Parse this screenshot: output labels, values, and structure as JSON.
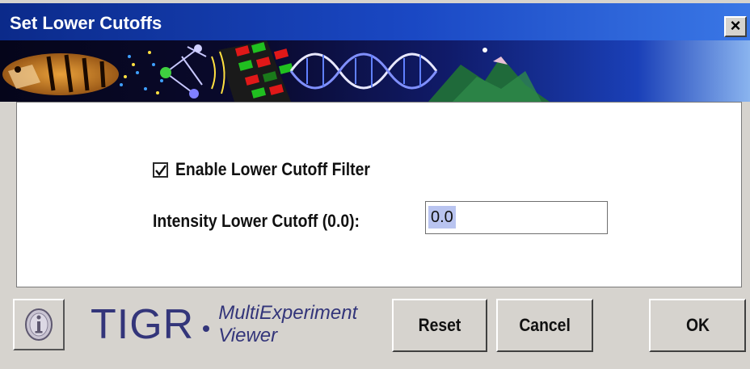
{
  "window": {
    "title": "Set Lower Cutoffs",
    "close_symbol": "×",
    "close_icon": "close-icon"
  },
  "banner": {
    "icon": "tigr-banner-image",
    "colors": {
      "sky_left": "#05051a",
      "sky_right": "#1a40b8",
      "accent": "#e01818"
    }
  },
  "form": {
    "enable_filter": {
      "label": "Enable Lower Cutoff Filter",
      "checked": true
    },
    "intensity": {
      "label": "Intensity Lower Cutoff (0.0):",
      "value": "0.0"
    }
  },
  "footer": {
    "info_icon": "info-icon",
    "logo": {
      "word": "TIGR",
      "product_line1": "MultiExperiment",
      "product_line2": "Viewer",
      "color": "#33357a"
    },
    "buttons": {
      "reset": "Reset",
      "cancel": "Cancel",
      "ok": "OK"
    }
  }
}
